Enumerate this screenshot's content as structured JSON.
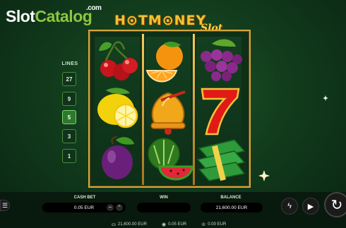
{
  "watermark": {
    "slot": "Slot",
    "catalog": "Catalog",
    "com": ".com"
  },
  "game_title": {
    "hot": "H⊙T",
    "money": "M⊙NEY",
    "slot": "Slot"
  },
  "lines": {
    "label": "LINES",
    "options": [
      "27",
      "9",
      "5",
      "3",
      "1"
    ],
    "selected": "5"
  },
  "reels": [
    [
      "cherries",
      "lemon",
      "plum"
    ],
    [
      "orange",
      "bell",
      "watermelon"
    ],
    [
      "grapes",
      "seven",
      "cash-stack"
    ]
  ],
  "controls": {
    "cash_bet_label": "CASH BET",
    "cash_bet_value": "0.05 EUR",
    "win_label": "WIN",
    "win_value": "",
    "balance_label": "BALANCE",
    "balance_value": "21,600.00 EUR"
  },
  "footer": {
    "balance": "21,600.00 EUR",
    "bet": "0.05 EUR",
    "win": "0.00 EUR"
  },
  "colors": {
    "accent_gold": "#d8a63a",
    "background_green": "#123d1d",
    "lime": "#8cc63f"
  }
}
